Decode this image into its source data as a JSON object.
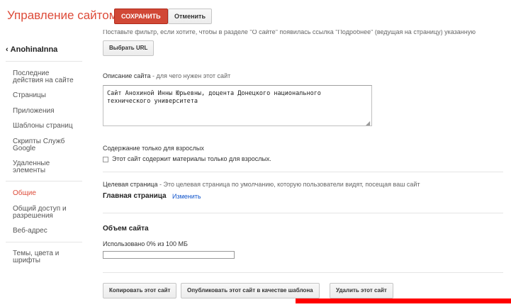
{
  "header": {
    "title": "Управление сайтом",
    "save_label": "СОХРАНИТЬ",
    "cancel_label": "Отменить"
  },
  "top_cut_text": "Поставьте фильтр, если хотите, чтобы в разделе \"О сайте\" появилась ссылка \"Подробнее\" (ведущая на страницу) указанную",
  "sidebar": {
    "site_name": "AnohinaInna",
    "items": [
      {
        "label_1": "Последние",
        "label_2": "действия на сайте"
      },
      {
        "label_1": "Страницы",
        "label_2": ""
      },
      {
        "label_1": "Приложения",
        "label_2": ""
      },
      {
        "label_1": "Шаблоны страниц",
        "label_2": ""
      },
      {
        "label_1": "Скрипты Служб",
        "label_2": "Google"
      },
      {
        "label_1": "Удаленные",
        "label_2": "элементы"
      },
      {
        "label_1": "Общие",
        "label_2": ""
      },
      {
        "label_1": "Общий доступ и",
        "label_2": "разрешения"
      },
      {
        "label_1": "Веб-адрес",
        "label_2": ""
      },
      {
        "label_1": "Темы, цвета и",
        "label_2": "шрифты"
      }
    ],
    "active_item": "Общие"
  },
  "main": {
    "select_url_label": "Выбрать URL",
    "description_label": "Описание сайта",
    "description_hint": " - для чего нужен этот сайт",
    "description_value": "Сайт Анохиной Инны Юрьевны, доцента Донецкого национального технического университета",
    "adult_label": "Содержание только для взрослых",
    "adult_checkbox_label": "Этот сайт содержит материалы только для взрослых.",
    "adult_checked": false,
    "landing_label": "Целевая страница",
    "landing_hint": " - Это целевая страница по умолчанию, которую пользователи видят, посещая ваш сайт",
    "landing_value": "Главная страница",
    "landing_change": "Изменить",
    "volume_title": "Объем сайта",
    "usage_text": "Использовано 0% из 100 МБ",
    "usage_percent": 0,
    "copy_button": "Копировать этот сайт",
    "publish_button": "Опубликовать этот сайт в качестве шаблона",
    "delete_button": "Удалить этот сайт"
  },
  "colors": {
    "accent": "#dd4b39",
    "save_button": "#d14836",
    "link": "#1155cc",
    "overlay_bar": "#ff0000"
  },
  "icons": {
    "back": "chevron-left-icon",
    "resize": "resize-grip-icon"
  }
}
